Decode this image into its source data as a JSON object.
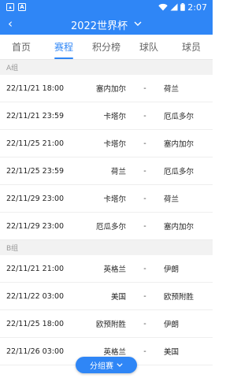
{
  "statusbar": {
    "time": "2:07",
    "left_icons": [
      "image-notification-icon",
      "a-notification-icon"
    ],
    "right_icons": [
      "wifi-icon",
      "signal-icon",
      "battery-icon"
    ]
  },
  "appbar": {
    "title": "2022世界杯",
    "back_icon": "chevron-left-icon",
    "dropdown_icon": "chevron-down-icon"
  },
  "tabs": [
    {
      "label": "首页",
      "active": false
    },
    {
      "label": "赛程",
      "active": true
    },
    {
      "label": "积分榜",
      "active": false
    },
    {
      "label": "球队",
      "active": false
    },
    {
      "label": "球员",
      "active": false
    }
  ],
  "groups": [
    {
      "name": "A组",
      "matches": [
        {
          "time": "22/11/21 18:00",
          "home": "塞内加尔",
          "vs": "-",
          "away": "荷兰"
        },
        {
          "time": "22/11/21 23:59",
          "home": "卡塔尔",
          "vs": "-",
          "away": "厄瓜多尔"
        },
        {
          "time": "22/11/25 21:00",
          "home": "卡塔尔",
          "vs": "-",
          "away": "塞内加尔"
        },
        {
          "time": "22/11/25 23:59",
          "home": "荷兰",
          "vs": "-",
          "away": "厄瓜多尔"
        },
        {
          "time": "22/11/29 23:00",
          "home": "卡塔尔",
          "vs": "-",
          "away": "荷兰"
        },
        {
          "time": "22/11/29 23:00",
          "home": "厄瓜多尔",
          "vs": "-",
          "away": "塞内加尔"
        }
      ]
    },
    {
      "name": "B组",
      "matches": [
        {
          "time": "22/11/21 21:00",
          "home": "英格兰",
          "vs": "-",
          "away": "伊朗"
        },
        {
          "time": "22/11/22 03:00",
          "home": "美国",
          "vs": "-",
          "away": "欧预附胜"
        },
        {
          "time": "22/11/25 18:00",
          "home": "欧预附胜",
          "vs": "-",
          "away": "伊朗"
        },
        {
          "time": "22/11/26 03:00",
          "home": "英格兰",
          "vs": "-",
          "away": "美国"
        }
      ]
    }
  ],
  "fab": {
    "label": "分组赛",
    "icon": "chevron-down-icon"
  },
  "colors": {
    "primary": "#2f86f6",
    "group_bg": "#f2f2f2"
  }
}
